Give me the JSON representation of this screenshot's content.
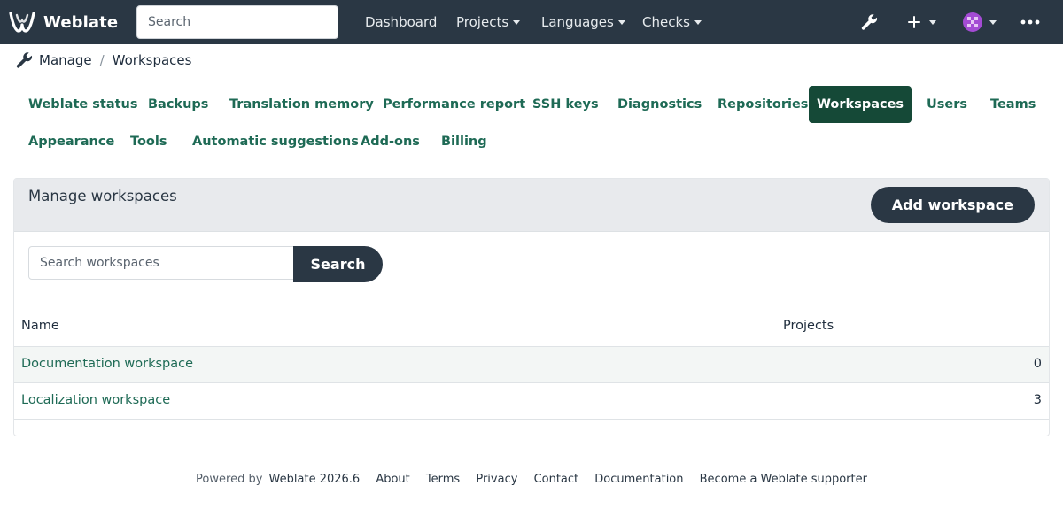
{
  "navbar": {
    "brand": "Weblate",
    "search_placeholder": "Search",
    "links": [
      {
        "label": "Dashboard"
      },
      {
        "label": "Projects"
      },
      {
        "label": "Languages"
      },
      {
        "label": "Checks"
      }
    ],
    "icons": [
      "wrench-icon",
      "plus-icon",
      "avatar",
      "more-icon"
    ]
  },
  "breadcrumb": {
    "root": "Manage",
    "current": "Workspaces"
  },
  "tabs": [
    {
      "label": "Weblate status",
      "active": false
    },
    {
      "label": "Backups",
      "active": false
    },
    {
      "label": "Translation memory",
      "active": false
    },
    {
      "label": "Performance report",
      "active": false
    },
    {
      "label": "SSH keys",
      "active": false
    },
    {
      "label": "Diagnostics",
      "active": false
    },
    {
      "label": "Repositories",
      "active": false
    },
    {
      "label": "Workspaces",
      "active": true
    },
    {
      "label": "Users",
      "active": false
    },
    {
      "label": "Teams",
      "active": false
    },
    {
      "label": "Appearance",
      "active": false
    },
    {
      "label": "Tools",
      "active": false
    },
    {
      "label": "Automatic suggestions",
      "active": false
    },
    {
      "label": "Add-ons",
      "active": false
    },
    {
      "label": "Billing",
      "active": false
    }
  ],
  "panel": {
    "title": "Manage workspaces",
    "add_button": "Add workspace",
    "search_placeholder": "Search workspaces",
    "search_button": "Search",
    "columns": [
      "Name",
      "Projects"
    ],
    "rows": [
      {
        "name": "Documentation workspace",
        "projects": "0"
      },
      {
        "name": "Localization workspace",
        "projects": "3"
      }
    ]
  },
  "footer": {
    "powered_by": "Powered by",
    "version": "Weblate 2026.6",
    "links": [
      "About",
      "Terms",
      "Privacy",
      "Contact",
      "Documentation",
      "Become a Weblate supporter"
    ]
  },
  "colors": {
    "navbar": "#2a3744",
    "accent": "#1e6a55",
    "active_tab": "#154937"
  }
}
